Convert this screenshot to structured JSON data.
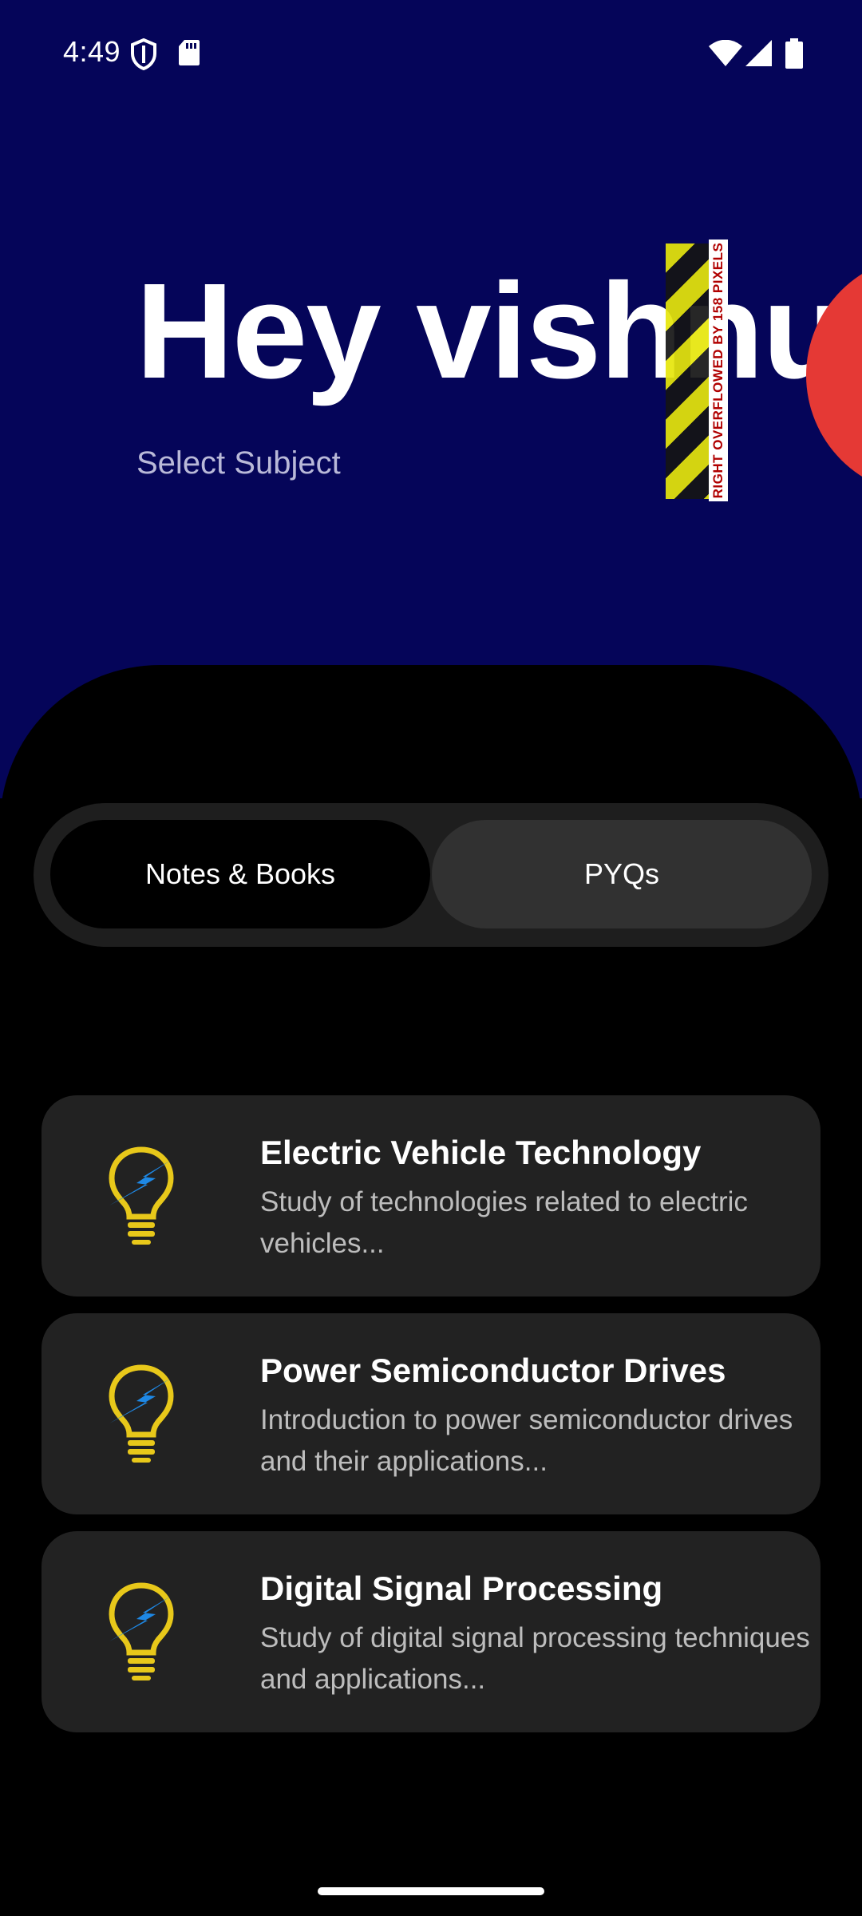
{
  "status_bar": {
    "time": "4:49",
    "left_icons": [
      "shield-icon",
      "sd-card-icon"
    ],
    "right_icons": [
      "wifi-icon",
      "signal-icon",
      "battery-icon"
    ]
  },
  "header": {
    "greeting": "Hey vishnu",
    "subtitle": "Select Subject",
    "overflow_warning": "RIGHT OVERFLOWED BY 158 PIXELS",
    "background_color": "#050559",
    "avatar_color": "#e53935"
  },
  "tabs": {
    "notes_label": "Notes & Books",
    "pyqs_label": "PYQs",
    "selected": "Notes & Books"
  },
  "subjects": [
    {
      "title": "Electric Vehicle Technology",
      "description": "Study of technologies related to electric vehicles...",
      "icon": "lightbulb-icon"
    },
    {
      "title": "Power Semiconductor Drives",
      "description": "Introduction to power semiconductor drives and their applications...",
      "icon": "lightbulb-icon"
    },
    {
      "title": "Digital Signal Processing",
      "description": "Study of digital signal processing techniques and applications...",
      "icon": "lightbulb-icon"
    }
  ]
}
